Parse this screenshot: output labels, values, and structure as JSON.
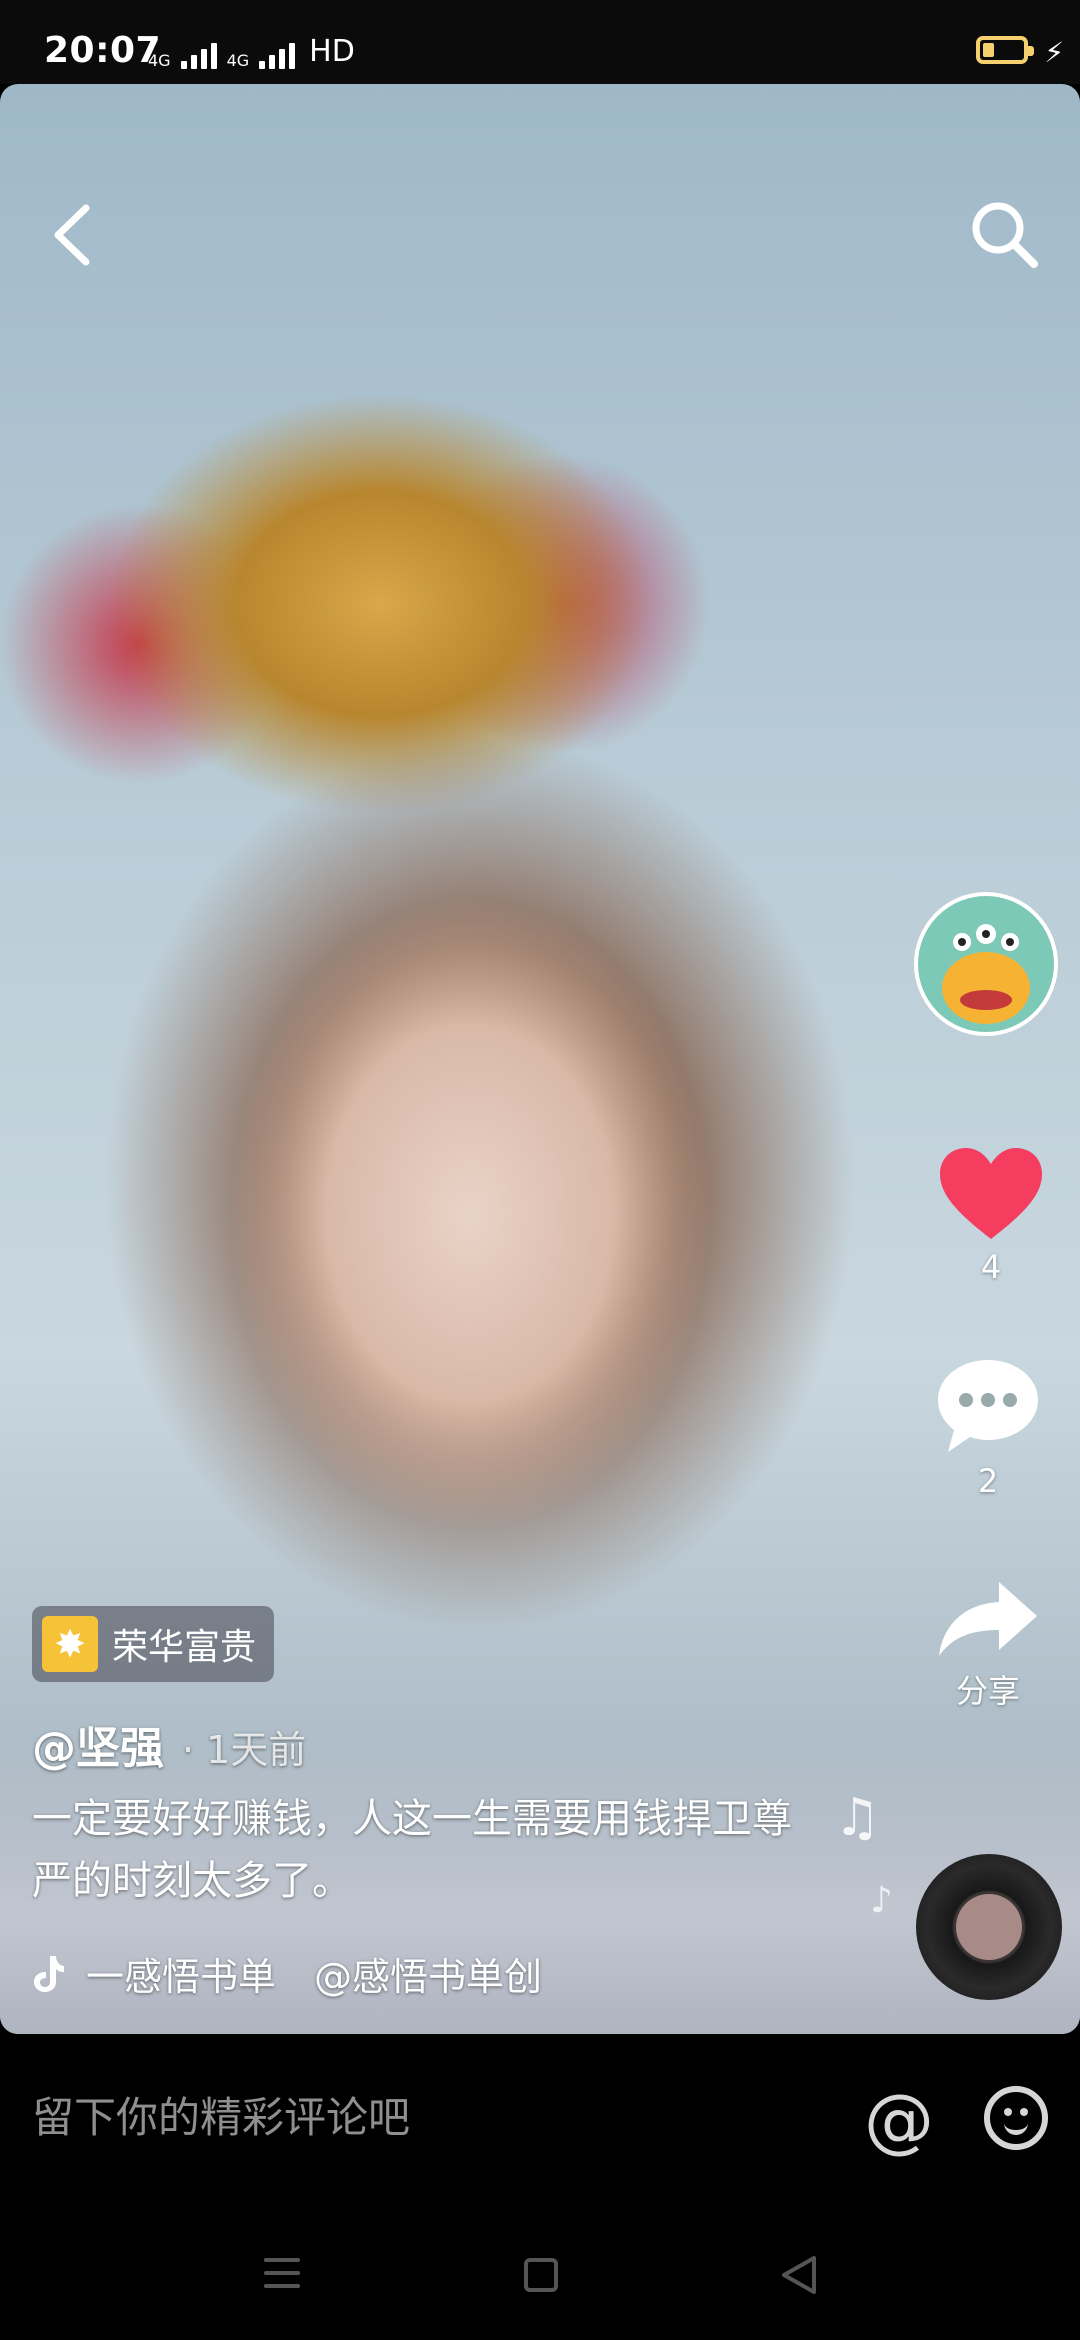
{
  "status_bar": {
    "time": "20:07",
    "network1": "4G",
    "network2": "4G",
    "hd_label": "HD",
    "battery_level": 0.3,
    "battery_color": "#f4d06f"
  },
  "video": {
    "effect_label": "荣华富贵",
    "username": "@坚强",
    "time_ago": "· 1天前",
    "caption": "一定要好好赚钱，人这一生需要用钱捍卫尊严的时刻太多了。",
    "music_text": "一感悟书单　@感悟书单创",
    "like_count": "4",
    "comment_count": "2",
    "share_label": "分享",
    "like_color": "#f43d5f"
  },
  "comment_bar": {
    "placeholder": "留下你的精彩评论吧"
  },
  "icons": {
    "back": "chevron-left-icon",
    "search": "search-icon",
    "heart": "heart-icon",
    "comment": "comment-bubble-icon",
    "share": "share-arrow-icon",
    "at": "at-icon",
    "emoji": "emoji-icon"
  }
}
